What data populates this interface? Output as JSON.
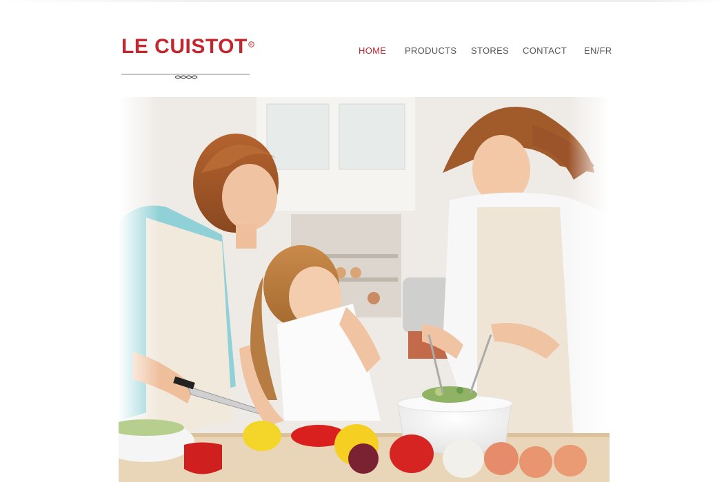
{
  "brand": {
    "name": "LE CUISTOT",
    "accent_color": "#c4262e"
  },
  "nav": {
    "items": [
      {
        "label": "HOME",
        "active": true
      },
      {
        "label": "PRODUCTS",
        "active": false
      },
      {
        "label": "STORES",
        "active": false
      },
      {
        "label": "CONTACT",
        "active": false
      },
      {
        "label": "EN/FR",
        "active": false
      }
    ]
  }
}
